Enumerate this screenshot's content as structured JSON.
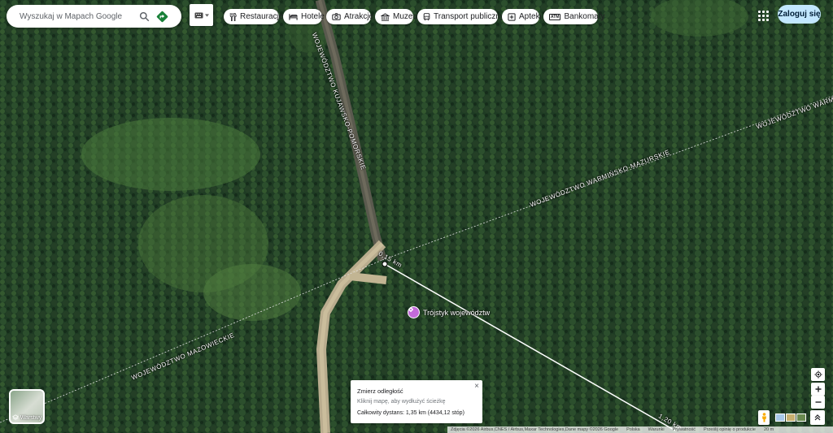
{
  "search": {
    "placeholder": "Wyszukaj w Mapach Google"
  },
  "categories": [
    {
      "label": "Restauracje",
      "icon": "restaurant-icon"
    },
    {
      "label": "Hotele",
      "icon": "hotel-icon"
    },
    {
      "label": "Atrakcje",
      "icon": "camera-icon"
    },
    {
      "label": "Muzea",
      "icon": "museum-icon"
    },
    {
      "label": "Transport publiczny",
      "icon": "transit-icon"
    },
    {
      "label": "Apteki",
      "icon": "pharmacy-icon"
    },
    {
      "label": "Bankomaty",
      "icon": "atm-icon"
    }
  ],
  "atm_badge": "ATM",
  "header": {
    "signin_label": "Zaloguj się"
  },
  "map": {
    "region_labels": {
      "kujawsko": "WOJEWÓDZTWO KUJAWSKO-POMORSKIE",
      "warminsko_top": "WOJEWÓDZTWO WARMIŃSKO",
      "warminsko": "WOJEWÓDZTWO WARMIŃSKO-MAZURSKIE",
      "mazowieckie": "WOJEWÓDZTWO MAZOWIECKIE"
    },
    "poi_label": "Trójstyk województw",
    "measure_marks": {
      "start": "0,15 km",
      "mid": "1,20 km"
    }
  },
  "measure_panel": {
    "title": "Zmierz odległość",
    "hint": "Kliknij mapę, aby wydłużyć ścieżkę",
    "total": "Całkowity dystans: 1,35 km (4434,12 stóp)",
    "close": "×"
  },
  "layers": {
    "label": "Warstwy"
  },
  "footer": {
    "attribution": "Zdjęcia ©2026 Airbus,CNES / Airbus,Maxar Technologies,Dane mapy ©2026 Google",
    "poland": "Polska",
    "terms": "Warunki",
    "privacy": "Prywatność",
    "feedback": "Prześlij opinię o produkcie",
    "scale": "20 m"
  },
  "colors": {
    "accent": "#1a73e8",
    "directions": "#188038",
    "signin_bg": "#c2e7ff",
    "poi": "#c26ad9"
  }
}
